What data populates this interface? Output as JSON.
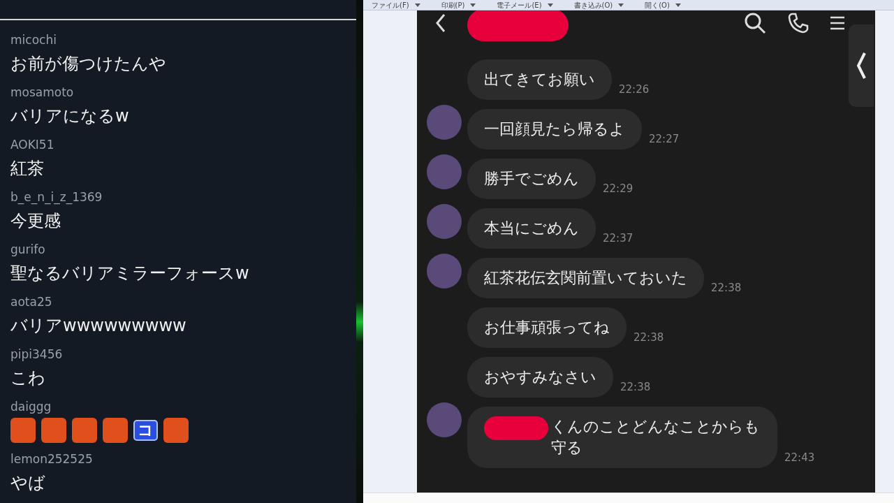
{
  "chat": {
    "messages": [
      {
        "user": "micochi",
        "parts": [
          {
            "kind": "text",
            "text": "お前が傷つけたんや"
          }
        ]
      },
      {
        "user": "mosamoto",
        "parts": [
          {
            "kind": "text",
            "text": "バリアになるw"
          }
        ]
      },
      {
        "user": "AOKI51",
        "parts": [
          {
            "kind": "text",
            "text": "紅茶"
          }
        ]
      },
      {
        "user": "b_e_n_i_z_1369",
        "parts": [
          {
            "kind": "text",
            "text": "今更感"
          }
        ]
      },
      {
        "user": "gurifo",
        "parts": [
          {
            "kind": "text",
            "text": "聖なるバリアミラーフォースw"
          }
        ]
      },
      {
        "user": "aota25",
        "parts": [
          {
            "kind": "text",
            "text": "バリアwwwwwwwww"
          }
        ]
      },
      {
        "user": "pipi3456",
        "parts": [
          {
            "kind": "text",
            "text": "こわ"
          }
        ]
      },
      {
        "user": "daiggg",
        "parts": [
          {
            "kind": "emote"
          },
          {
            "kind": "emote"
          },
          {
            "kind": "emote"
          },
          {
            "kind": "emote"
          },
          {
            "kind": "letter",
            "text": "コ"
          },
          {
            "kind": "emote"
          }
        ]
      },
      {
        "user": "lemon252525",
        "parts": [
          {
            "kind": "text",
            "text": "やば"
          }
        ]
      }
    ]
  },
  "viewer": {
    "toolbar": [
      "ファイル(F)",
      "印刷(P)",
      "電子メール(E)",
      "書き込み(O)",
      "開く(O)"
    ],
    "conversation": {
      "header_redacted": true,
      "messages": [
        {
          "text": "出てきてお願い",
          "time": "22:26",
          "avatar": false,
          "redacted": false
        },
        {
          "text": "一回顔見たら帰るよ",
          "time": "22:27",
          "avatar": true,
          "redacted": false
        },
        {
          "text": "勝手でごめん",
          "time": "22:29",
          "avatar": true,
          "redacted": false
        },
        {
          "text": "本当にごめん",
          "time": "22:37",
          "avatar": true,
          "redacted": false
        },
        {
          "text": "紅茶花伝玄関前置いておいた",
          "time": "22:38",
          "avatar": true,
          "redacted": false
        },
        {
          "text": "お仕事頑張ってね",
          "time": "22:38",
          "avatar": false,
          "redacted": false
        },
        {
          "text": "おやすみなさい",
          "time": "22:38",
          "avatar": false,
          "redacted": false
        },
        {
          "text": "くんのことどんなことからも守る",
          "time": "22:43",
          "avatar": true,
          "redacted": true
        }
      ]
    }
  }
}
